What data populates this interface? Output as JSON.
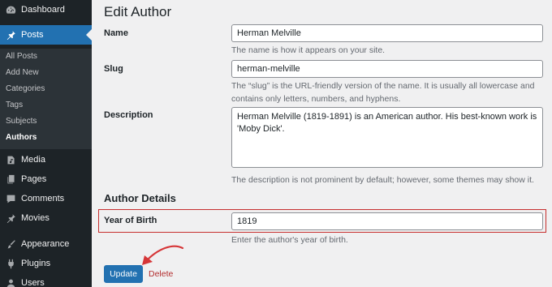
{
  "sidebar": {
    "items": [
      {
        "label": "Dashboard",
        "icon": "dashboard-icon"
      },
      {
        "label": "Posts",
        "icon": "pin-icon",
        "current": true
      },
      {
        "label": "Media",
        "icon": "media-icon"
      },
      {
        "label": "Pages",
        "icon": "pages-icon"
      },
      {
        "label": "Comments",
        "icon": "comment-icon"
      },
      {
        "label": "Movies",
        "icon": "pin-icon"
      },
      {
        "label": "Appearance",
        "icon": "brush-icon"
      },
      {
        "label": "Plugins",
        "icon": "plugin-icon"
      },
      {
        "label": "Users",
        "icon": "users-icon"
      }
    ],
    "submenu": [
      "All Posts",
      "Add New",
      "Categories",
      "Tags",
      "Subjects",
      "Authors"
    ],
    "active_submenu": "Authors"
  },
  "page": {
    "title": "Edit Author",
    "name": {
      "label": "Name",
      "value": "Herman Melville",
      "help": "The name is how it appears on your site."
    },
    "slug": {
      "label": "Slug",
      "value": "herman-melville",
      "help": "The “slug” is the URL-friendly version of the name. It is usually all lowercase and contains only letters, numbers, and hyphens."
    },
    "description": {
      "label": "Description",
      "value": "Herman Melville (1819-1891) is an American author. His best-known work is 'Moby Dick'.",
      "help": "The description is not prominent by default; however, some themes may show it."
    },
    "section_title": "Author Details",
    "year_of_birth": {
      "label": "Year of Birth",
      "value": "1819",
      "help": "Enter the author's year of birth."
    },
    "update_label": "Update",
    "delete_label": "Delete"
  },
  "colors": {
    "sidebar_bg": "#1d2327",
    "accent": "#2271b1",
    "highlight_border": "#c62e2e",
    "delete": "#b32d2e"
  }
}
